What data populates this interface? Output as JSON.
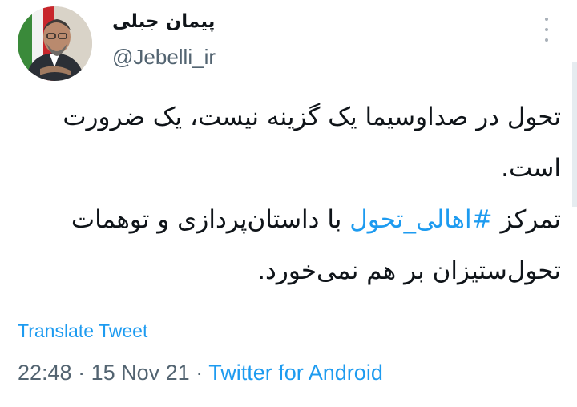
{
  "author": {
    "display_name": "پیمان جبلی",
    "handle": "@Jebelli_ir"
  },
  "tweet": {
    "line1": "تحول در صداوسیما یک گزینه نیست، یک ضرورت است.",
    "line2_before": "تمرکز",
    "hashtag": "#اهالی_تحول",
    "line2_after": "با داستان‌پردازی و توهمات تحول‌ستیزان بر هم نمی‌خورد."
  },
  "translate_label": "Translate Tweet",
  "meta": {
    "time": "22:48",
    "separator": "·",
    "date": "15 Nov 21",
    "source": "Twitter for Android"
  },
  "colors": {
    "link": "#1d9bf0",
    "text": "#0f1419",
    "secondary": "#536471"
  },
  "icons": {
    "more": "vertical-ellipsis-icon"
  }
}
